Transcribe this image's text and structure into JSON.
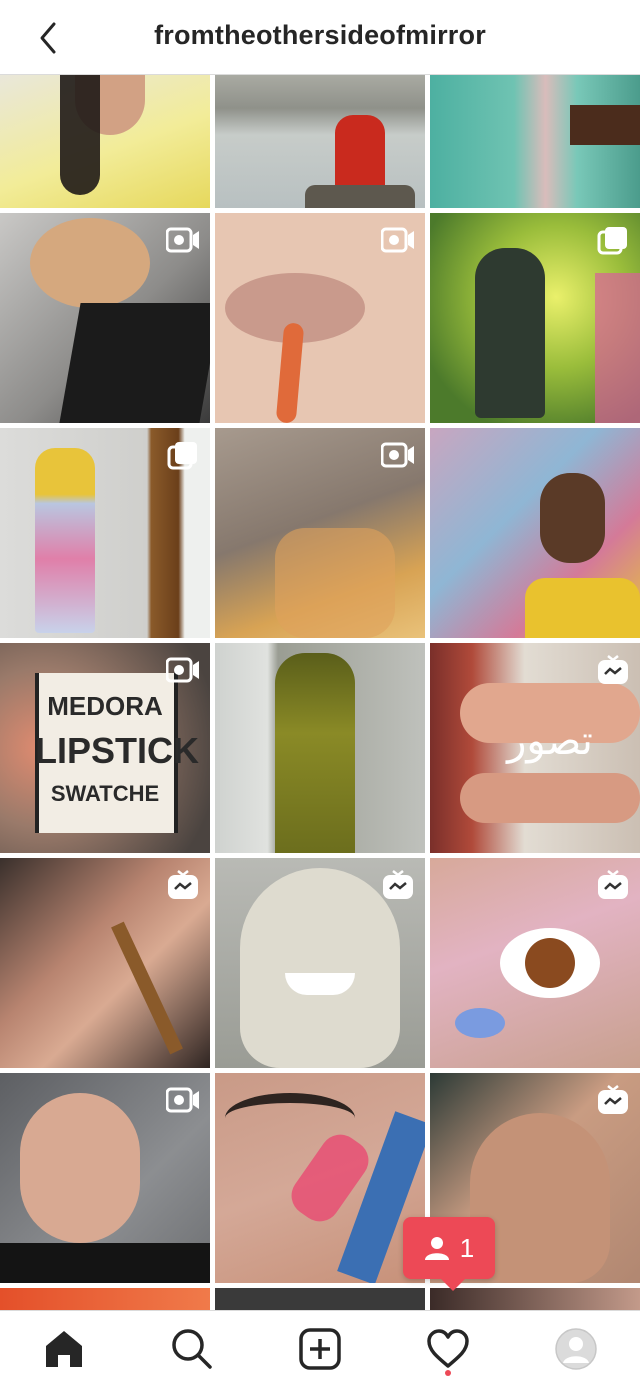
{
  "header": {
    "username": "fromtheothersideofmirror",
    "back_icon": "chevron-left-icon"
  },
  "grid": {
    "tiles": [
      {
        "badge": null
      },
      {
        "badge": null
      },
      {
        "badge": null
      },
      {
        "badge": "video"
      },
      {
        "badge": "video"
      },
      {
        "badge": "carousel"
      },
      {
        "badge": "carousel"
      },
      {
        "badge": "video"
      },
      {
        "badge": null
      },
      {
        "badge": "video",
        "overlay": [
          "MEDORA",
          "LIPSTICK",
          "SWATCHE"
        ]
      },
      {
        "badge": null
      },
      {
        "badge": "igtv",
        "overlay": [
          "تصور"
        ]
      },
      {
        "badge": "igtv"
      },
      {
        "badge": "igtv"
      },
      {
        "badge": "igtv"
      },
      {
        "badge": "video"
      },
      {
        "badge": null
      },
      {
        "badge": "igtv"
      }
    ]
  },
  "notification": {
    "count": "1",
    "icon": "person-icon",
    "color": "#ed4956"
  },
  "bottom_nav": {
    "items": [
      "home-icon",
      "search-icon",
      "new-post-icon",
      "activity-heart-icon",
      "profile-avatar"
    ]
  }
}
